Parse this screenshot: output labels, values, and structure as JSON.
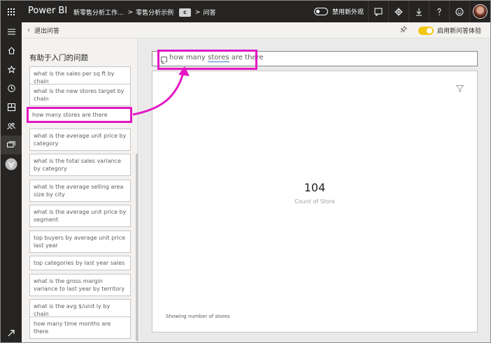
{
  "app": {
    "brand": "Power BI"
  },
  "breadcrumb": {
    "workspace": "新零售分析工作...",
    "sep1": ">",
    "report": "零售分析示例",
    "pill": "c",
    "sep2": ">",
    "page": "问答"
  },
  "topbar": {
    "toggle_label": "禁用新外观"
  },
  "subbar": {
    "exit_label": "退出问答",
    "new_qa_label": "启用新问答体验"
  },
  "panel": {
    "title": "有助于入门的问题",
    "suggestions": [
      "what is the sales per sq ft by chain",
      "what is the new stores target by chain",
      "how many stores are there",
      "what is the average unit price by category",
      "what is the total sales variance by category",
      "what is the average selling area size by city",
      "what is the average unit price by segment",
      "top buyers by average unit price last year",
      "top categories by last year sales",
      "what is the gross margin variance to last year by territory",
      "what is the avg $/unit ly by chain",
      "how many time months are there"
    ]
  },
  "qa": {
    "query_pre": "how many ",
    "query_underlined": "stores",
    "query_post": " are there"
  },
  "result": {
    "value": "104",
    "label": "Count of Store",
    "footer": "Showing number of stores"
  },
  "colors": {
    "highlight": "#e317c4",
    "topbar": "#252423",
    "accent_toggle": "#f2c811"
  },
  "icons": [
    "app-launcher-icon",
    "chat-icon",
    "gear-icon",
    "download-icon",
    "help-icon",
    "smiley-icon",
    "home-icon",
    "star-icon",
    "clock-icon",
    "apps-icon",
    "people-icon",
    "workspace-icon",
    "pin-icon",
    "filter-icon",
    "expand-icon"
  ]
}
